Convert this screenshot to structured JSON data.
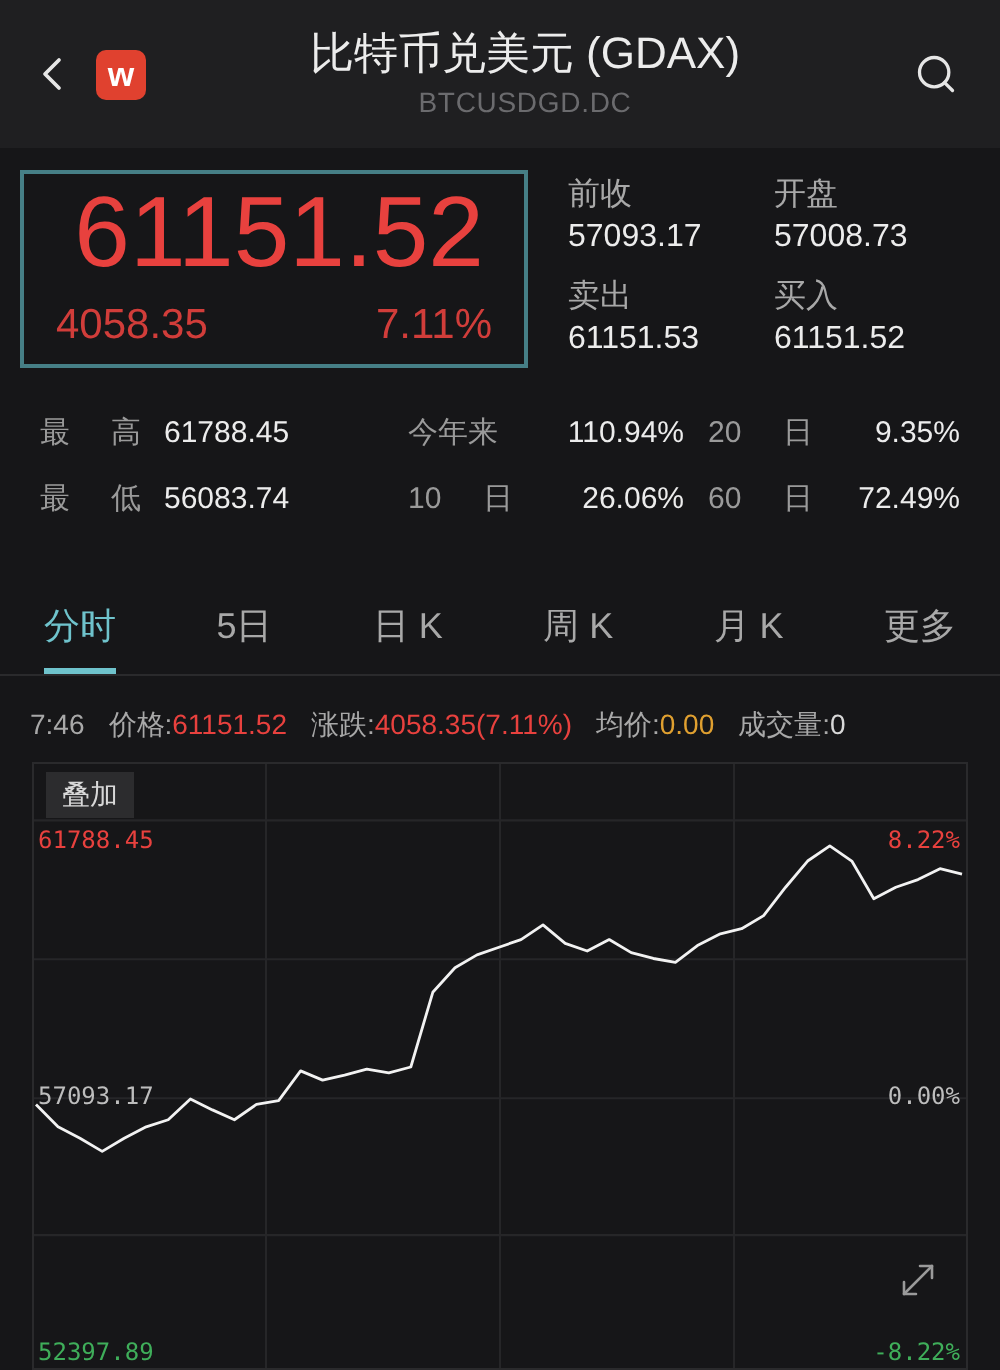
{
  "header": {
    "title": "比特币兑美元 (GDAX)",
    "code": "BTCUSDGD.DC",
    "logo_text": "w"
  },
  "quote": {
    "price": "61151.52",
    "change": "4058.35",
    "change_pct": "7.11%"
  },
  "quote_fields": [
    {
      "label": "前收",
      "value": "57093.17"
    },
    {
      "label": "开盘",
      "value": "57008.73"
    },
    {
      "label": "卖出",
      "value": "61151.53"
    },
    {
      "label": "买入",
      "value": "61151.52"
    }
  ],
  "stats": [
    [
      {
        "label": "最 高",
        "value": "61788.45"
      },
      {
        "label": "今年来",
        "value": "110.94%"
      },
      {
        "label": "20 日",
        "value": "9.35%"
      }
    ],
    [
      {
        "label": "最 低",
        "value": "56083.74"
      },
      {
        "label": "10 日",
        "value": "26.06%"
      },
      {
        "label": "60 日",
        "value": "72.49%"
      }
    ]
  ],
  "tabs": [
    {
      "label": "分时",
      "selected": true
    },
    {
      "label": "5日",
      "selected": false
    },
    {
      "label": "日 K",
      "selected": false
    },
    {
      "label": "周 K",
      "selected": false
    },
    {
      "label": "月 K",
      "selected": false
    },
    {
      "label": "更多",
      "selected": false
    }
  ],
  "info_bar": {
    "time": "7:46",
    "items": [
      {
        "label": "价格:",
        "value": "61151.52",
        "color": "#e8413e"
      },
      {
        "label": "涨跌:",
        "value": "4058.35(7.11%)",
        "color": "#e8413e"
      },
      {
        "label": "均价:",
        "value": "0.00",
        "color": "#e0a030"
      },
      {
        "label": "成交量:",
        "value": "0",
        "color": "#d8d8d8"
      }
    ]
  },
  "chart": {
    "overlay_button": "叠加",
    "left_labels": [
      {
        "color": "#3fae5a"
      },
      {
        "color": "#bdbdbd"
      },
      {
        "color": "#e8413e"
      }
    ],
    "right_labels": [
      {
        "text": "8.22%",
        "color": "#e8413e"
      },
      {
        "text": "0.00%",
        "color": "#bdbdbd"
      },
      {
        "text": "-8.22%",
        "color": "#3fae5a"
      }
    ],
    "chart_data": {
      "type": "line",
      "ylim": [
        52102,
        63193
      ],
      "yticks": [
        {
          "value": 52397.89,
          "label": "52397.89"
        },
        {
          "value": 57093.17,
          "label": "57093.17"
        },
        {
          "value": 61788.45,
          "label": "61788.45"
        }
      ],
      "series": [
        {
          "color": "#f2f2f2",
          "values": [
            56940,
            56530,
            56320,
            56080,
            56320,
            56530,
            56660,
            57040,
            56840,
            56660,
            56940,
            57010,
            57560,
            57390,
            57480,
            57590,
            57520,
            57630,
            59000,
            59450,
            59690,
            59830,
            59970,
            60240,
            59900,
            59760,
            59970,
            59730,
            59620,
            59550,
            59860,
            60070,
            60170,
            60410,
            60930,
            61410,
            61690,
            61410,
            60720,
            60930,
            61070,
            61270,
            61170
          ]
        }
      ]
    }
  }
}
